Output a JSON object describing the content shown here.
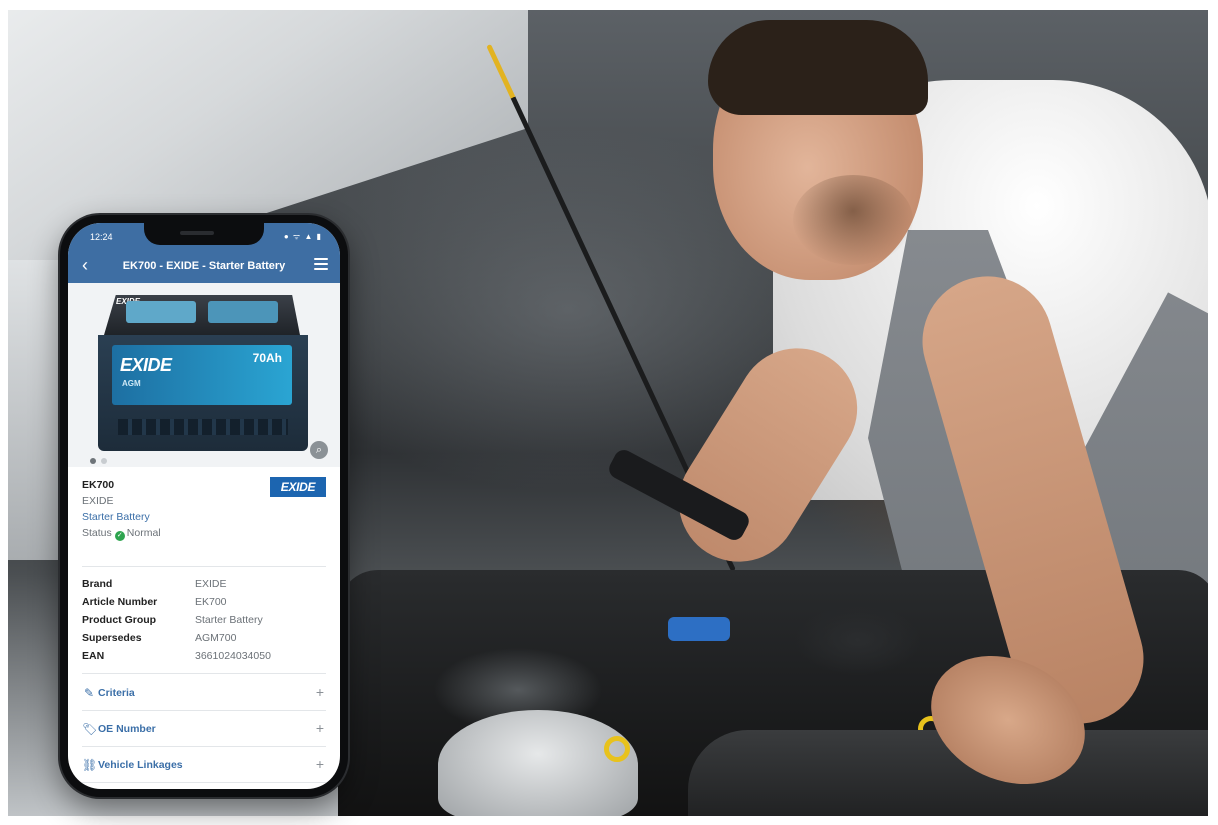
{
  "phone": {
    "status": {
      "time": "12:24",
      "icons": "● ᯤ ▲ ▮"
    },
    "appbar": {
      "back": "‹",
      "title": "EK700 - EXIDE - Starter Battery"
    },
    "gallery": {
      "battery_brand": "EXIDE",
      "battery_sub": "AGM",
      "battery_capacity": "70Ah",
      "zoom_icon": "⌕"
    },
    "summary": {
      "article": "EK700",
      "brand": "EXIDE",
      "group": "Starter Battery",
      "status_label": "Status",
      "status_value": "Normal",
      "logo": "EXIDE"
    },
    "details": [
      {
        "key": "Brand",
        "value": "EXIDE"
      },
      {
        "key": "Article Number",
        "value": "EK700"
      },
      {
        "key": "Product Group",
        "value": "Starter Battery"
      },
      {
        "key": "Supersedes",
        "value": "AGM700"
      },
      {
        "key": "EAN",
        "value": "3661024034050"
      }
    ],
    "sections": [
      {
        "label": "Criteria",
        "icon": "✎",
        "toggle": "+"
      },
      {
        "label": "OE Number",
        "icon": "🏷",
        "toggle": "+"
      },
      {
        "label": "Vehicle Linkages",
        "icon": "⛓",
        "toggle": "+"
      }
    ]
  },
  "colors": {
    "appbar": "#3e6ea3",
    "link": "#3b6fa8",
    "status_ok": "#2ea44f",
    "brand_badge": "#1c65b0"
  }
}
